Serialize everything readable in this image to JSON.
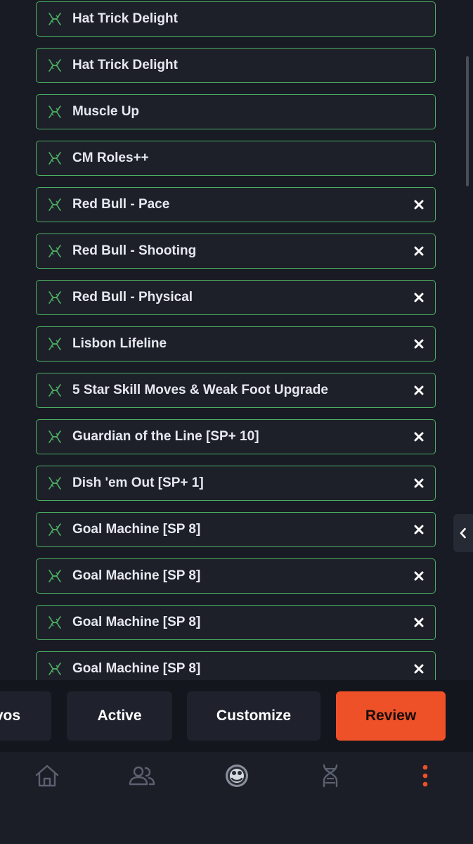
{
  "evolutions": [
    {
      "label": "Hat Trick Delight",
      "removable": false
    },
    {
      "label": "Hat Trick Delight",
      "removable": false
    },
    {
      "label": "Muscle Up",
      "removable": false
    },
    {
      "label": "CM Roles++",
      "removable": false
    },
    {
      "label": "Red Bull - Pace",
      "removable": true
    },
    {
      "label": "Red Bull - Shooting",
      "removable": true
    },
    {
      "label": "Red Bull - Physical",
      "removable": true
    },
    {
      "label": "Lisbon Lifeline",
      "removable": true
    },
    {
      "label": "5 Star Skill Moves & Weak Foot Upgrade",
      "removable": true
    },
    {
      "label": "Guardian of the Line [SP+ 10]",
      "removable": true
    },
    {
      "label": "Dish 'em Out [SP+ 1]",
      "removable": true
    },
    {
      "label": "Goal Machine [SP 8]",
      "removable": true
    },
    {
      "label": "Goal Machine [SP 8]",
      "removable": true
    },
    {
      "label": "Goal Machine [SP 8]",
      "removable": true
    },
    {
      "label": "Goal Machine [SP 8]",
      "removable": true
    }
  ],
  "action_bar": {
    "evos_label": "vos",
    "active_label": "Active",
    "customize_label": "Customize",
    "review_label": "Review"
  },
  "bottom_nav": {
    "items": [
      "home-icon",
      "players-icon",
      "club-crest-icon",
      "dna-icon",
      "more-vertical-icon"
    ],
    "active": "more-vertical-icon"
  },
  "colors": {
    "background": "#181b24",
    "item_border": "#4caf62",
    "accent": "#ee5128",
    "text": "#e6e8ee"
  }
}
